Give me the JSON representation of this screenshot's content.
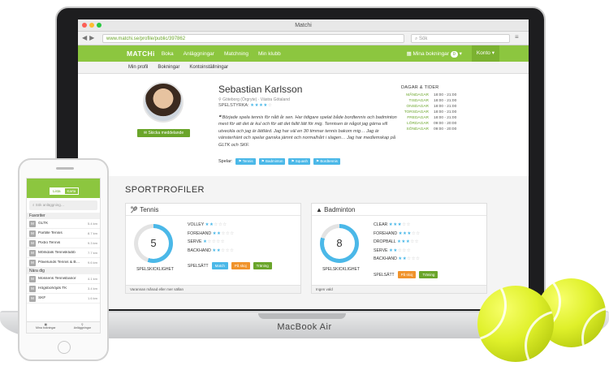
{
  "browser": {
    "title": "Matchi",
    "url": "www.matchi.se/profile/public/397862",
    "search_placeholder": "Sök"
  },
  "nav": {
    "logo": "MATCHi",
    "items": [
      "Boka",
      "Anläggningar",
      "Matchning",
      "Min klubb"
    ],
    "bookings_label": "Mina bokningar",
    "bookings_count": "0",
    "account_label": "Konto"
  },
  "subnav": [
    "Min profil",
    "Bokningar",
    "Kontoinställningar"
  ],
  "profile": {
    "name": "Sebastian Karlsson",
    "location": "Göteborg (Örgryte) · Västra Götaland",
    "strength_label": "SPELSTYRKA:",
    "message_button": "Skicka meddelande",
    "quote": "Började spela tennis för nått år sen. Har tidigare spelat både bordtennis och badminton mest för att det är kul och för att det fallit lätt för mig. Tennisen är något jag gärna vill utveckla och jag är lättlärd. Jag har väl en 30 timmar tennis bakom mig… Jag är vänsterhänt och spelar ganska jämnt och normalhårt i slagen… Jag har medlemskap på GLTK och SKF.",
    "plays_label": "Spelar:",
    "plays": [
      "Tennis",
      "Badminton",
      "Squash",
      "Bordtennis"
    ],
    "times_title": "DAGAR & TIDER",
    "times": [
      {
        "day": "MÅNDAGAR",
        "hours": "18:00 - 21:00"
      },
      {
        "day": "TISDAGAR",
        "hours": "18:00 - 21:00"
      },
      {
        "day": "ONSDAGAR",
        "hours": "18:00 - 21:00"
      },
      {
        "day": "TORSDAGAR",
        "hours": "18:00 - 21:00"
      },
      {
        "day": "FREDAGAR",
        "hours": "18:00 - 21:00"
      },
      {
        "day": "LÖRDAGAR",
        "hours": "09:00 - 20:00"
      },
      {
        "day": "SÖNDAGAR",
        "hours": "09:00 - 20:00"
      }
    ]
  },
  "sportprofiles": {
    "title": "SPORTPROFILER",
    "cards": [
      {
        "sport": "Tennis",
        "level": "5",
        "level_fraction": 0.55,
        "skill_label": "SPELSKICKLIGHET",
        "skills": [
          {
            "name": "VOLLEY",
            "stars": 2
          },
          {
            "name": "FOREHAND",
            "stars": 2
          },
          {
            "name": "SERVE",
            "stars": 1
          },
          {
            "name": "BACKHAND",
            "stars": 2
          }
        ],
        "spels_label": "SPELSÄTT",
        "modes": [
          {
            "label": "Match",
            "color": "#4bb8e8"
          },
          {
            "label": "På skoj",
            "color": "#f0932b"
          },
          {
            "label": "Träning",
            "color": "#6aa52a"
          }
        ],
        "footer": "Varannan månad eller mer sällan"
      },
      {
        "sport": "Badminton",
        "level": "8",
        "level_fraction": 0.8,
        "skill_label": "SPELSKICKLIGHET",
        "skills": [
          {
            "name": "CLEAR",
            "stars": 3
          },
          {
            "name": "FOREHAND",
            "stars": 3
          },
          {
            "name": "DROPBALL",
            "stars": 3
          },
          {
            "name": "SERVE",
            "stars": 2
          },
          {
            "name": "BACKHAND",
            "stars": 2
          }
        ],
        "spels_label": "SPELSÄTT",
        "modes": [
          {
            "label": "På skoj",
            "color": "#f0932b"
          },
          {
            "label": "Träning",
            "color": "#6aa52a"
          }
        ],
        "footer": "Ingen vald"
      }
    ]
  },
  "phone": {
    "tabs": [
      "Lista",
      "Karta"
    ],
    "search_placeholder": "Sök anläggning…",
    "favorites_title": "Favoriter",
    "favorites": [
      {
        "name": "GLTK",
        "km": "5.4 km"
      },
      {
        "name": "Partille Tennis",
        "km": "8.7 km"
      },
      {
        "name": "Pixbo Tennis",
        "km": "9.3 km"
      },
      {
        "name": "Mölndals Tennisklubb",
        "km": "7.7 km"
      },
      {
        "name": "Påvelunds Tennis & B…",
        "km": "9.6 km"
      }
    ],
    "nearby_title": "Nära dig",
    "nearby": [
      {
        "name": "Mossens Tennisbanor",
        "km": "4.1 km"
      },
      {
        "name": "Högsbohöjds TK",
        "km": "3.4 km"
      },
      {
        "name": "SKF",
        "km": "1.6 km"
      }
    ],
    "bottom_tabs": [
      "Mina bokningar",
      "Anläggningar"
    ]
  },
  "device": {
    "brand": "MacBook Air"
  },
  "colors": {
    "brand_green": "#8cc63f",
    "accent_blue": "#4bb8e8"
  }
}
